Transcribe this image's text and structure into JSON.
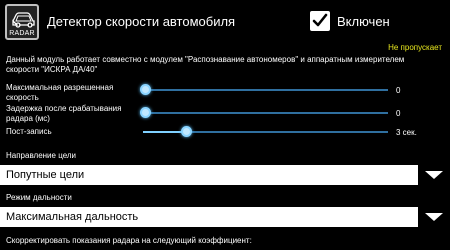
{
  "header": {
    "icon_label": "RADAR",
    "icon_name": "car-radar-icon",
    "title": "Детектор скорости автомобиля",
    "enabled_checked": true,
    "enabled_label": "Включен"
  },
  "status_text": "Не пропускает",
  "description": "Данный модуль работает совместно с модулем \"Распознавание автономеров\" и аппаратным измерителем скорости \"ИСКРА ДА/40\"",
  "sliders": [
    {
      "label": "Максимальная разрешенная скорость",
      "value_text": "0",
      "fraction": 0.0
    },
    {
      "label": "Задержка после срабатывания радара (мс)",
      "value_text": "0",
      "fraction": 0.0
    },
    {
      "label": "Пост-запись",
      "value_text": "3 сек.",
      "fraction": 0.17
    }
  ],
  "direction": {
    "label": "Направление цели",
    "selected": "Попутные цели"
  },
  "range": {
    "label": "Режим дальности",
    "selected": "Максимальная дальность"
  },
  "correction_label": "Скорректировать показания радара на следующий коэффициент:",
  "colors": {
    "status": "#e8e81e",
    "slider_track": "#2f6f9f",
    "slider_thumb": "#8ad4ff"
  }
}
